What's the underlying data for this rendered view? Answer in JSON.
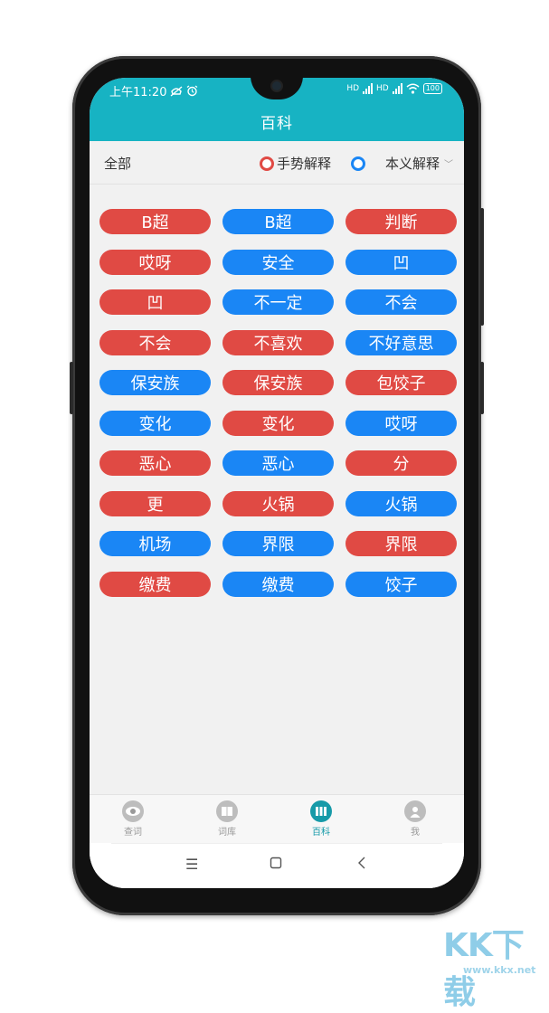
{
  "status_bar": {
    "time": "上午11:20",
    "battery": "100",
    "net1": "HD",
    "net2": "HD"
  },
  "header": {
    "title": "百科"
  },
  "filter": {
    "all_label": "全部",
    "legend": [
      {
        "label": "手势解释",
        "color": "#e04a44"
      },
      {
        "label": "本义解释",
        "color": "#1a86f5"
      }
    ]
  },
  "words": [
    {
      "label": "B超",
      "type": "gesture"
    },
    {
      "label": "B超",
      "type": "meaning"
    },
    {
      "label": "判断",
      "type": "gesture"
    },
    {
      "label": "哎呀",
      "type": "gesture"
    },
    {
      "label": "安全",
      "type": "meaning"
    },
    {
      "label": "凹",
      "type": "meaning"
    },
    {
      "label": "凹",
      "type": "gesture"
    },
    {
      "label": "不一定",
      "type": "meaning"
    },
    {
      "label": "不会",
      "type": "meaning"
    },
    {
      "label": "不会",
      "type": "gesture"
    },
    {
      "label": "不喜欢",
      "type": "gesture"
    },
    {
      "label": "不好意思",
      "type": "meaning"
    },
    {
      "label": "保安族",
      "type": "meaning"
    },
    {
      "label": "保安族",
      "type": "gesture"
    },
    {
      "label": "包饺子",
      "type": "gesture"
    },
    {
      "label": "变化",
      "type": "meaning"
    },
    {
      "label": "变化",
      "type": "gesture"
    },
    {
      "label": "哎呀",
      "type": "meaning"
    },
    {
      "label": "恶心",
      "type": "gesture"
    },
    {
      "label": "恶心",
      "type": "meaning"
    },
    {
      "label": "分",
      "type": "gesture"
    },
    {
      "label": "更",
      "type": "gesture"
    },
    {
      "label": "火锅",
      "type": "gesture"
    },
    {
      "label": "火锅",
      "type": "meaning"
    },
    {
      "label": "机场",
      "type": "meaning"
    },
    {
      "label": "界限",
      "type": "meaning"
    },
    {
      "label": "界限",
      "type": "gesture"
    },
    {
      "label": "缴费",
      "type": "gesture"
    },
    {
      "label": "缴费",
      "type": "meaning"
    },
    {
      "label": "饺子",
      "type": "meaning"
    }
  ],
  "tabs": [
    {
      "label": "查词",
      "icon": "eye-icon",
      "active": false
    },
    {
      "label": "词库",
      "icon": "book-icon",
      "active": false
    },
    {
      "label": "百科",
      "icon": "library-icon",
      "active": true
    },
    {
      "label": "我",
      "icon": "user-icon",
      "active": false
    }
  ],
  "watermark": {
    "brand": "KK下载",
    "url": "www.kkx.net"
  }
}
